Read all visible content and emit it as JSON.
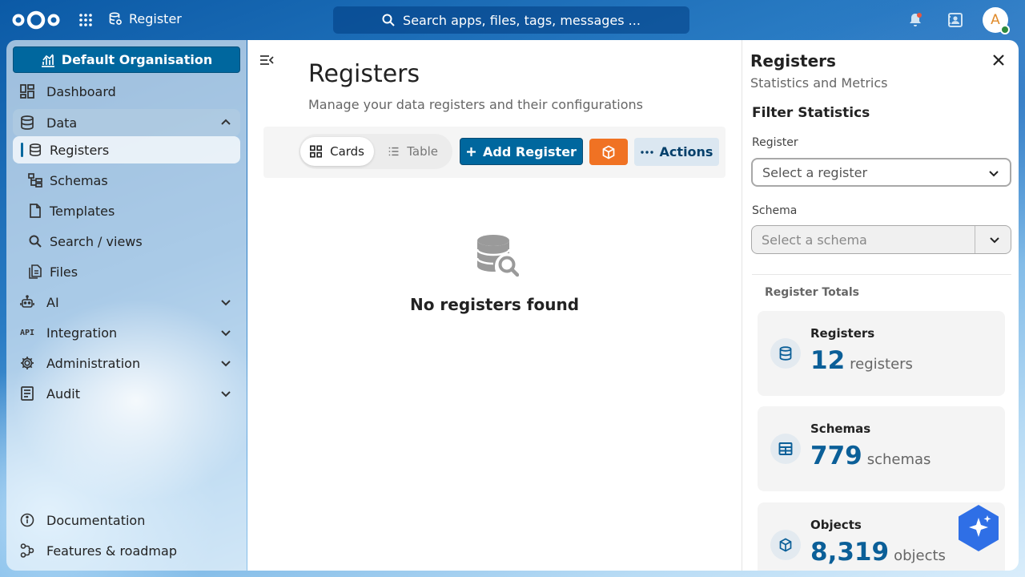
{
  "header": {
    "app_name": "Register",
    "search_placeholder": "Search apps, files, tags, messages ...",
    "avatar_initial": "A"
  },
  "sidebar": {
    "organisation": "Default Organisation",
    "items": [
      {
        "label": "Dashboard"
      },
      {
        "label": "Data"
      },
      {
        "label": "Registers"
      },
      {
        "label": "Schemas"
      },
      {
        "label": "Templates"
      },
      {
        "label": "Search / views"
      },
      {
        "label": "Files"
      },
      {
        "label": "AI"
      },
      {
        "label": "Integration"
      },
      {
        "label": "Administration"
      },
      {
        "label": "Audit"
      }
    ],
    "footer": [
      {
        "label": "Documentation"
      },
      {
        "label": "Features & roadmap"
      }
    ]
  },
  "main": {
    "title": "Registers",
    "subtitle": "Manage your data registers and their configurations",
    "view_cards": "Cards",
    "view_table": "Table",
    "add_button": "Add Register",
    "actions_button": "Actions",
    "empty_text": "No registers found"
  },
  "panel": {
    "title": "Registers",
    "subtitle": "Statistics and Metrics",
    "filter_title": "Filter Statistics",
    "register_label": "Register",
    "register_placeholder": "Select a register",
    "schema_label": "Schema",
    "schema_placeholder": "Select a schema",
    "totals_title": "Register Totals",
    "stats": [
      {
        "label": "Registers",
        "value": "12",
        "unit": "registers"
      },
      {
        "label": "Schemas",
        "value": "779",
        "unit": "schemas"
      },
      {
        "label": "Objects",
        "value": "8,319",
        "unit": "objects"
      }
    ]
  },
  "colors": {
    "primary": "#00679e",
    "accent_orange": "#f07223",
    "stat_number": "#0b5f98"
  }
}
